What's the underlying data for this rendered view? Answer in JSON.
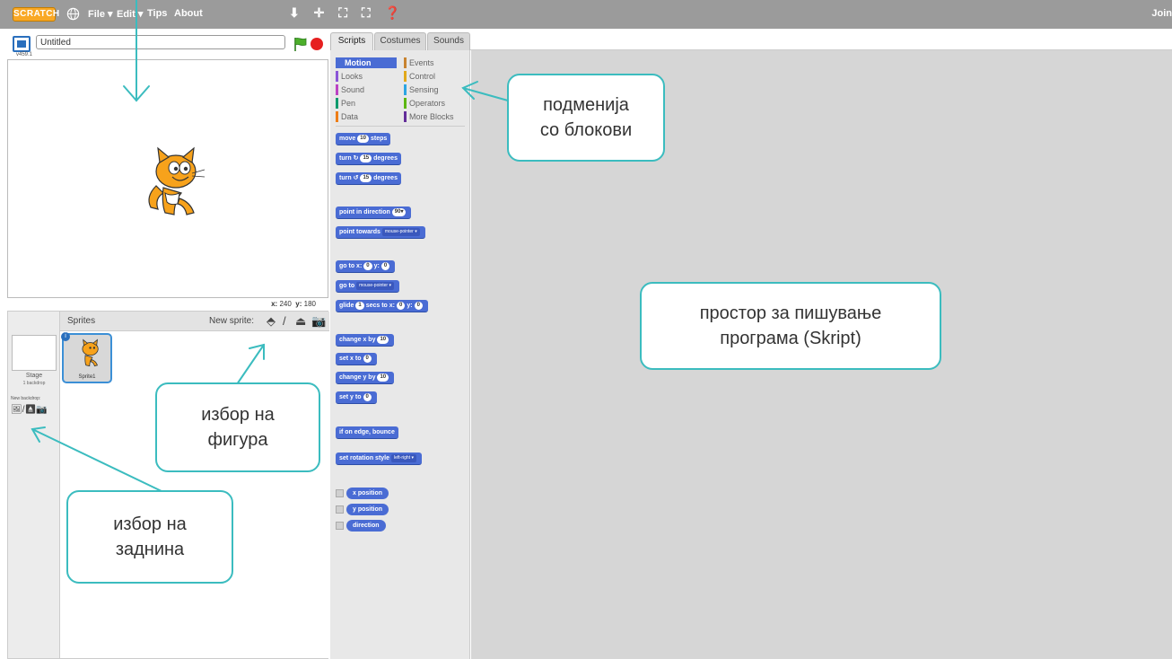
{
  "menu": {
    "logo": "SCRATCH",
    "items": [
      "File ▾",
      "Edit ▾",
      "Tips",
      "About"
    ],
    "tools": "⬇ ✛ ⛶ ⛶ ❓",
    "join": "Join"
  },
  "stage": {
    "project_title": "Untitled",
    "version": "v459.1",
    "coords": {
      "x_label": "x:",
      "x": "240",
      "y_label": "y:",
      "y": "180"
    }
  },
  "sprites": {
    "header": "Sprites",
    "new_sprite": "New sprite:",
    "stage_label": "Stage",
    "stage_sub": "1 backdrop",
    "new_backdrop": "New backdrop:",
    "sprite_name": "Sprite1"
  },
  "tabs": [
    "Scripts",
    "Costumes",
    "Sounds"
  ],
  "categories": {
    "left": [
      "Motion",
      "Looks",
      "Sound",
      "Pen",
      "Data"
    ],
    "right": [
      "Events",
      "Control",
      "Sensing",
      "Operators",
      "More Blocks"
    ]
  },
  "category_colors": {
    "Motion": "#4a6cd4",
    "Looks": "#8a55d7",
    "Sound": "#bb42c3",
    "Pen": "#0e9a6c",
    "Data": "#ee7d16",
    "Events": "#c88330",
    "Control": "#e1a91a",
    "Sensing": "#2ca5e2",
    "Operators": "#5cb712",
    "More Blocks": "#632d99"
  },
  "blocks": {
    "move": {
      "a": "move",
      "v": "10",
      "b": "steps"
    },
    "turn_right": {
      "a": "turn",
      "icon": "↻",
      "v": "15",
      "b": "degrees"
    },
    "turn_left": {
      "a": "turn",
      "icon": "↺",
      "v": "15",
      "b": "degrees"
    },
    "point_dir": {
      "a": "point in direction",
      "v": "90▾"
    },
    "point_towards": {
      "a": "point towards",
      "d": "mouse-pointer ▾"
    },
    "goto_xy": {
      "a": "go to x:",
      "v1": "0",
      "b": "y:",
      "v2": "0"
    },
    "goto": {
      "a": "go to",
      "d": "mouse-pointer ▾"
    },
    "glide": {
      "a": "glide",
      "v1": "1",
      "b": "secs to x:",
      "v2": "0",
      "c": "y:",
      "v3": "0"
    },
    "change_x": {
      "a": "change x by",
      "v": "10"
    },
    "set_x": {
      "a": "set x to",
      "v": "0"
    },
    "change_y": {
      "a": "change y by",
      "v": "10"
    },
    "set_y": {
      "a": "set y to",
      "v": "0"
    },
    "bounce": {
      "a": "if on edge, bounce"
    },
    "rotation": {
      "a": "set rotation style",
      "d": "left-right ▾"
    },
    "reporters": [
      "x position",
      "y position",
      "direction"
    ]
  },
  "annotations": {
    "block_submenu": [
      "подменија",
      "со блокови"
    ],
    "script_space": [
      "простор за пишување",
      "програма (Skript)"
    ],
    "sprite_choice": [
      "избор на",
      "фигура"
    ],
    "backdrop_choice": [
      "избор на",
      "заднина"
    ]
  },
  "accent": "#3bbcbf"
}
